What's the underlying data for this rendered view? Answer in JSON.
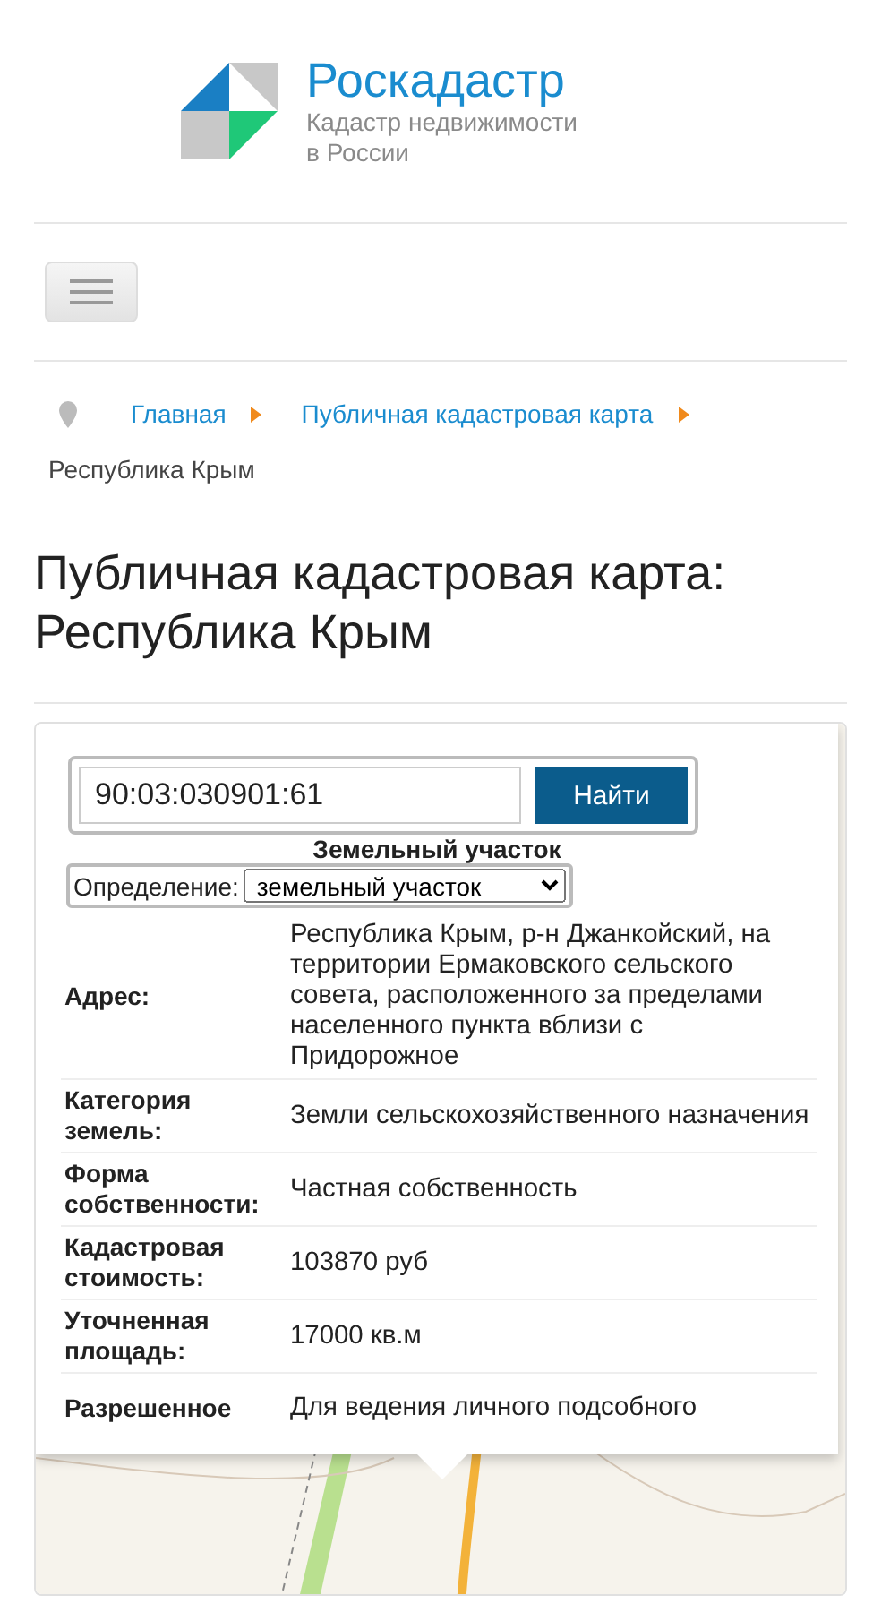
{
  "header": {
    "brand": "Роскадастр",
    "tagline": [
      "Кадастр недвижимости",
      "в России"
    ]
  },
  "breadcrumb": {
    "links": [
      "Главная",
      "Публичная кадастровая карта"
    ],
    "current": "Республика Крым"
  },
  "heading": [
    "Публичная кадастровая карта:",
    "Республика Крым"
  ],
  "map": {
    "search": {
      "value": "90:03:030901:61",
      "button": "Найти"
    },
    "popup": {
      "title": "Земельный участок",
      "select_label": "Определение:",
      "select_value": "земельный участок",
      "rows": [
        {
          "label": "Адрес:",
          "value": "Республика Крым, р-н Джанкойский, на территории Ермаковского сельского совета, расположенного за пределами населенного пункта вблизи с Придорожное"
        },
        {
          "label": "Категория земель:",
          "value": "Земли сельскохозяйственного назначения"
        },
        {
          "label": "Форма собственности:",
          "value": "Частная собственность"
        },
        {
          "label": "Кадастровая стоимость:",
          "value": "103870 руб"
        },
        {
          "label": "Уточненная площадь:",
          "value": "17000 кв.м"
        },
        {
          "label": "Разрешенное",
          "value": "Для ведения личного подсобного"
        }
      ]
    }
  }
}
